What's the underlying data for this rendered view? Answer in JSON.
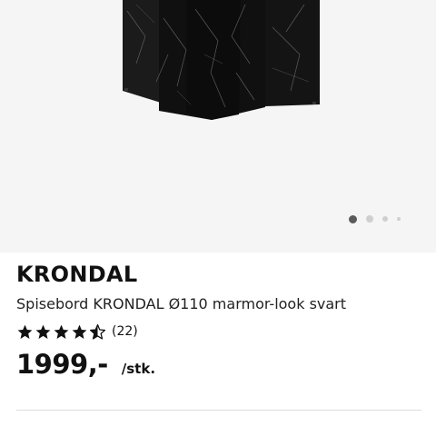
{
  "product": {
    "name": "KRONDAL",
    "description": "Spisebord KRONDAL Ø110 marmor-look svart",
    "rating": 4.5,
    "rating_max": 5,
    "rating_count": "(22)",
    "price": "1999,-",
    "unit": "/stk."
  },
  "gallery": {
    "image_count": 4,
    "active_index": 0
  },
  "colors": {
    "gallery_background": "#f5f5f5",
    "marble": "#151515",
    "active_dot": "#5a5a5a",
    "inactive_dot": "#cfcfcf"
  },
  "icons": {
    "rating_star": "star-icon",
    "half_star": "star-half-icon"
  }
}
